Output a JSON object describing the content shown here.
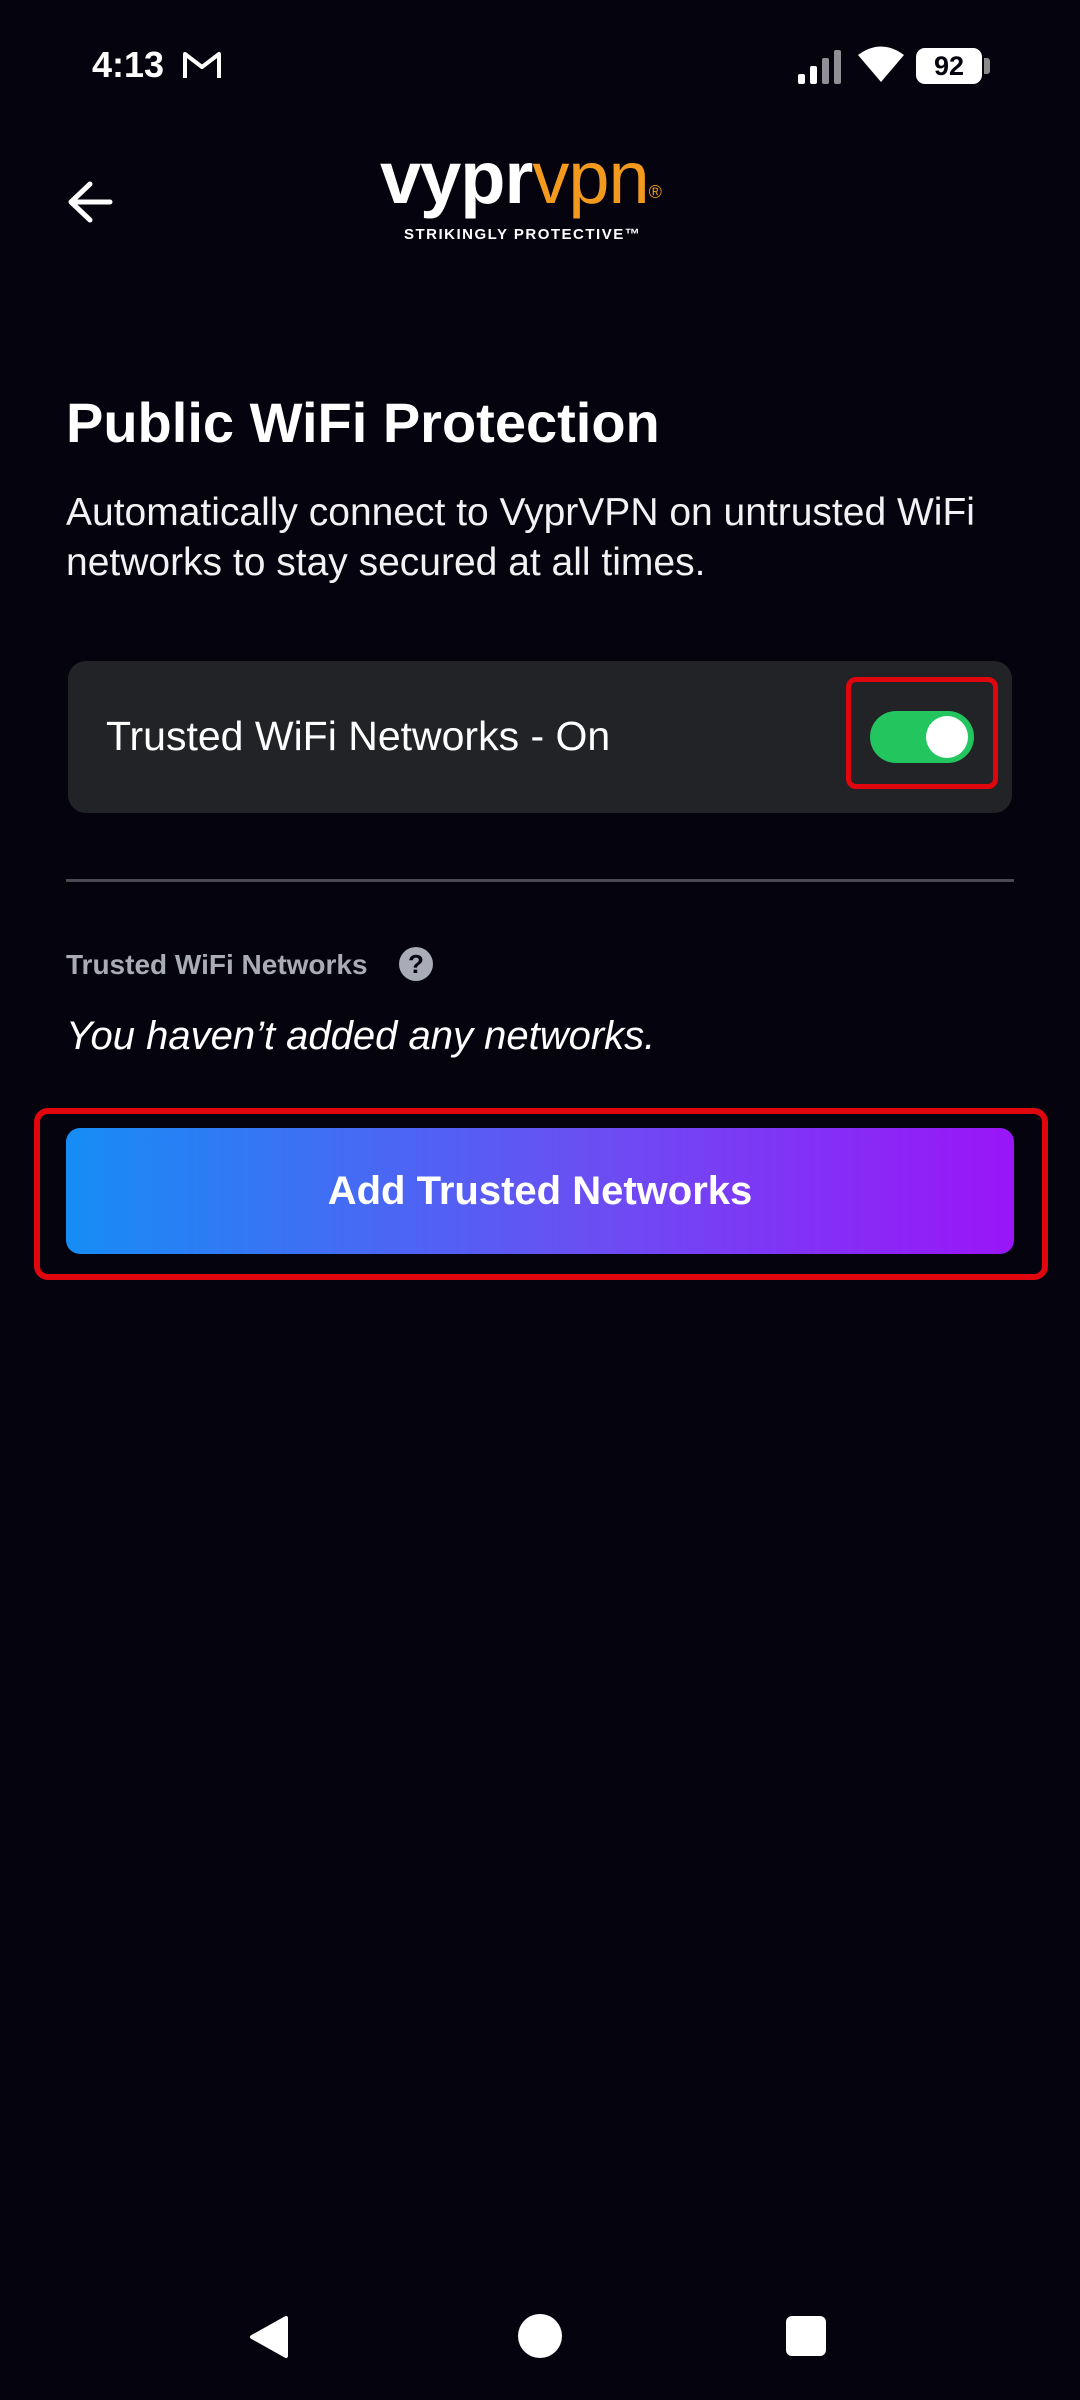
{
  "status_bar": {
    "time": "4:13",
    "battery": "92",
    "icons": [
      "gmail-icon",
      "signal-icon",
      "wifi-icon",
      "battery-icon"
    ]
  },
  "header": {
    "back_icon": "arrow-left-icon",
    "logo_part1": "vypr",
    "logo_part2": "vpn",
    "logo_reg": "®",
    "tagline": "STRIKINGLY PROTECTIVE™"
  },
  "main": {
    "title": "Public WiFi Protection",
    "description": "Automatically connect to VyprVPN on untrusted WiFi networks to stay secured at all times.",
    "toggle": {
      "label": "Trusted WiFi Networks - On",
      "state": "on"
    },
    "section_label": "Trusted WiFi Networks",
    "help_icon": "?",
    "empty_message": "You haven’t added any networks.",
    "cta_label": "Add Trusted Networks"
  },
  "colors": {
    "background": "#05030e",
    "accent_orange": "#f39a1e",
    "toggle_on": "#22c55e",
    "highlight_red": "#e0060e",
    "cta_gradient_start": "#168df5",
    "cta_gradient_end": "#9a15f8"
  },
  "nav_bar": {
    "icons": [
      "nav-back-icon",
      "nav-home-icon",
      "nav-recents-icon"
    ]
  }
}
